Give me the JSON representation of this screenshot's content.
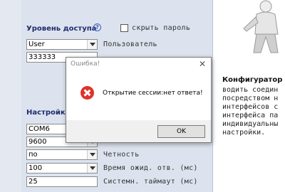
{
  "access": {
    "title": "Уровень доступа",
    "hide_password_label": "скрыть пароль",
    "user_select": "User",
    "user_label": "Пользователь",
    "password_value": "333333"
  },
  "settings": {
    "title": "Настройки",
    "port_value": "COM6",
    "baud_value": "9600",
    "parity_value": "по",
    "parity_label": "Четность",
    "timeout_value": "100",
    "timeout_label": "Время ожид. отв. (мс)",
    "sys_timeout_value": "25",
    "sys_timeout_label": "Системн. таймаут (мс)"
  },
  "info": {
    "title": "Конфигуратор",
    "lines": [
      "водить соедин",
      "посредством н",
      "интерфейсов с",
      "интерфейса па",
      "индивидуальны",
      "настройки."
    ]
  },
  "dialog": {
    "title": "Ошибка!",
    "close_glyph": "✕",
    "message": "Открытие сессии:нет ответа!",
    "ok_label": "OK"
  },
  "colors": {
    "panel": "#dde3ee",
    "heading": "#1e2c6e",
    "error_red": "#e0312b"
  }
}
